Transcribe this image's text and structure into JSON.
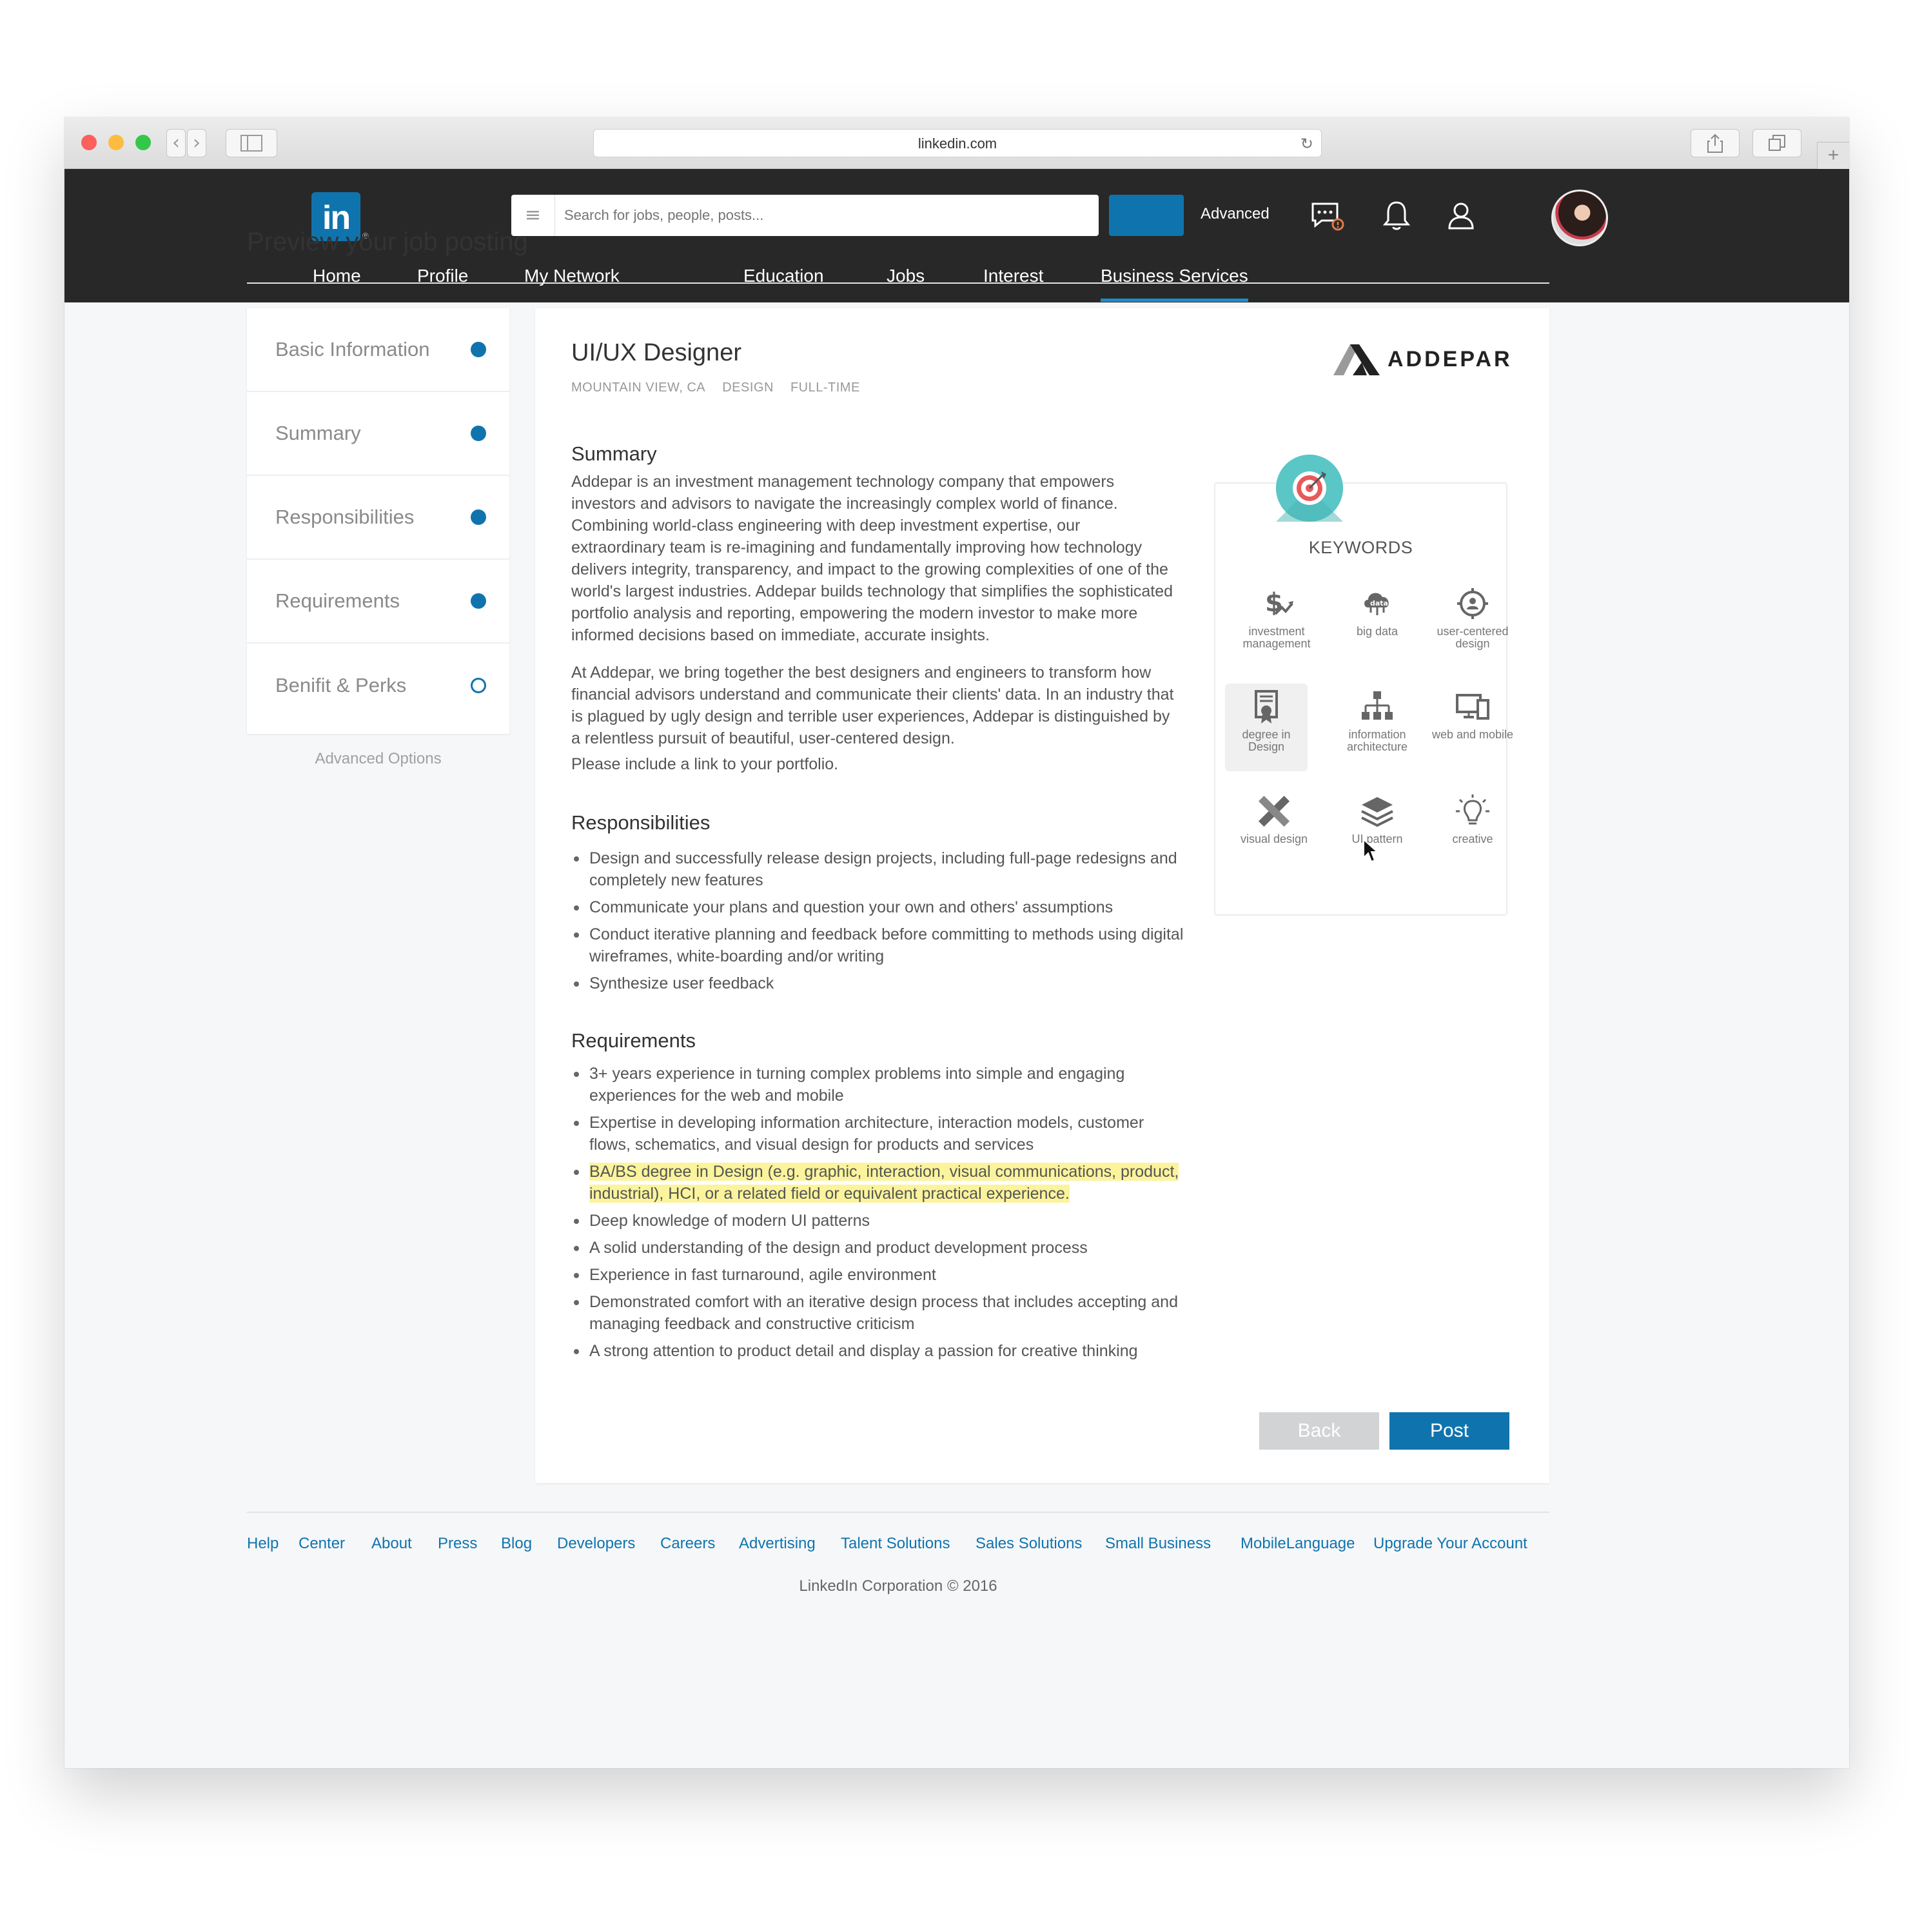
{
  "browser": {
    "url": "linkedin.com"
  },
  "header": {
    "logo_text": "in",
    "search_placeholder": "Search for jobs, people, posts...",
    "advanced_label": "Advanced",
    "nav": [
      "Home",
      "Profile",
      "My Network",
      "Education",
      "Jobs",
      "Interest",
      "Business Services"
    ],
    "active_nav": "Business Services"
  },
  "page": {
    "title": "Preview your job posting"
  },
  "steps": [
    {
      "label": "Basic Information",
      "status": "done"
    },
    {
      "label": "Summary",
      "status": "done"
    },
    {
      "label": "Responsibilities",
      "status": "done"
    },
    {
      "label": "Requirements",
      "status": "done"
    },
    {
      "label": "Benifit & Perks",
      "status": "pending"
    }
  ],
  "advanced_options": "Advanced Options",
  "job": {
    "title": "UI/UX Designer",
    "location": "MOUNTAIN VIEW, CA",
    "department": "DESIGN",
    "type": "FULL-TIME",
    "company": "ADDEPAR",
    "summary_heading": "Summary",
    "summary_paragraphs": [
      "Addepar is an investment management technology company that empowers investors and advisors to navigate the increasingly complex world of finance. Combining world-class engineering with deep investment expertise, our extraordinary team is re-imagining and fundamentally improving how technology delivers integrity, transparency, and impact to the growing complexities of one of the world's largest industries. Addepar builds technology that simplifies the sophisticated portfolio analysis and reporting, empowering the modern investor to make more informed decisions based on immediate, accurate insights.",
      "At Addepar, we bring together the best designers and engineers to transform how financial advisors understand and communicate their clients' data. In an industry that is plagued by ugly design and terrible user experiences, Addepar is distinguished by a relentless pursuit of beautiful, user-centered design.",
      "Please include a link to your portfolio."
    ],
    "responsibilities_heading": "Responsibilities",
    "responsibilities": [
      "Design and successfully release design projects, including full-page redesigns and completely new features",
      "Communicate your plans and question your own and others' assumptions",
      "Conduct iterative planning and feedback before committing to methods using digital wireframes, white-boarding and/or writing",
      "Synthesize user feedback"
    ],
    "requirements_heading": "Requirements",
    "requirements": [
      "3+ years experience in turning complex problems into simple and engaging experiences for the web and mobile",
      "Expertise in developing information architecture, interaction models, customer flows, schematics, and visual design for products and services",
      "BA/BS degree in Design (e.g. graphic, interaction, visual communications, product, industrial), HCI, or a related field or equivalent practical experience.",
      "Deep knowledge of modern UI patterns",
      "A solid understanding of the design and product development process",
      "Experience in fast turnaround, agile environment",
      "Demonstrated comfort with an iterative design process that includes accepting and managing feedback and constructive criticism",
      "A strong attention to product detail and display a passion for creative thinking"
    ],
    "highlighted_requirement_index": 2
  },
  "keywords": {
    "title": "KEYWORDS",
    "items": [
      {
        "label": "investment management",
        "icon": "investment-icon"
      },
      {
        "label": "big data",
        "icon": "big-data-icon"
      },
      {
        "label": "user-centered design",
        "icon": "user-centered-icon"
      },
      {
        "label": "degree in Design",
        "icon": "degree-icon"
      },
      {
        "label": "information architecture",
        "icon": "sitemap-icon"
      },
      {
        "label": "web and mobile",
        "icon": "devices-icon"
      },
      {
        "label": "visual design",
        "icon": "pencil-ruler-icon"
      },
      {
        "label": "UI pattern",
        "icon": "layers-icon"
      },
      {
        "label": "creative",
        "icon": "lightbulb-icon"
      }
    ],
    "selected": "degree in Design"
  },
  "actions": {
    "back": "Back",
    "post": "Post"
  },
  "footer": {
    "links": [
      "Help",
      "Center",
      "About",
      "Press",
      "Blog",
      "Developers",
      "Careers",
      "Advertising",
      "Talent Solutions",
      "Sales Solutions",
      "Small Business",
      "MobileLanguage",
      "Upgrade Your Account"
    ],
    "copyright": "LinkedIn Corporation © 2016"
  },
  "colors": {
    "linkedin_blue": "#0f74ae",
    "header_bg": "#282828",
    "highlight": "#fbf49c",
    "keyword_badge": "#5ac6c6"
  }
}
